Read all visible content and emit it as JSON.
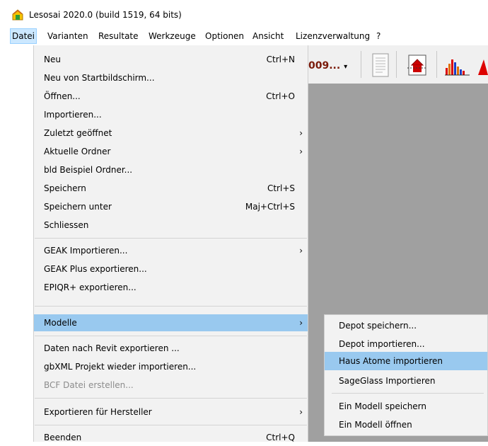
{
  "window": {
    "title": "Lesosai 2020.0 (build 1519, 64 bits)"
  },
  "menubar": {
    "items": [
      "Datei",
      "Varianten",
      "Resultate",
      "Werkzeuge",
      "Optionen",
      "Ansicht",
      "Lizenzverwaltung",
      "?"
    ]
  },
  "toolbar": {
    "combo_text": "009...",
    "combo_arrow": "▾"
  },
  "file_menu": {
    "items": [
      {
        "label": "Neu",
        "shortcut": "Ctrl+N"
      },
      {
        "label": "Neu von Startbildschirm..."
      },
      {
        "label": "Öffnen...",
        "shortcut": "Ctrl+O"
      },
      {
        "label": "Importieren..."
      },
      {
        "label": "Zuletzt geöffnet",
        "arrow": "›"
      },
      {
        "label": "Aktuelle Ordner",
        "arrow": "›"
      },
      {
        "label": "bld Beispiel Ordner..."
      },
      {
        "label": "Speichern",
        "shortcut": "Ctrl+S"
      },
      {
        "label": "Speichern unter",
        "shortcut": "Maj+Ctrl+S"
      },
      {
        "label": "Schliessen"
      },
      {
        "label": "GEAK Importieren...",
        "arrow": "›"
      },
      {
        "label": "GEAK Plus exportieren..."
      },
      {
        "label": "EPIQR+ exportieren..."
      },
      {
        "label": "Modelle",
        "arrow": "›",
        "highlighted": true
      },
      {
        "label": "Daten nach Revit exportieren ..."
      },
      {
        "label": "gbXML Projekt wieder importieren..."
      },
      {
        "label": "BCF Datei erstellen...",
        "disabled": true
      },
      {
        "label": "Exportieren für Hersteller",
        "arrow": "›"
      },
      {
        "label": "Beenden",
        "shortcut": "Ctrl+Q"
      }
    ]
  },
  "modelle_submenu": {
    "items": [
      {
        "label": "Depot speichern..."
      },
      {
        "label": "Depot importieren..."
      },
      {
        "label": "Haus Atome importieren",
        "highlighted": true
      },
      {
        "label": "SageGlass Importieren"
      },
      {
        "label": "Ein Modell speichern"
      },
      {
        "label": "Ein Modell öffnen"
      }
    ]
  },
  "colors": {
    "highlight": "#99c9ef",
    "menu_bg": "#f2f2f2",
    "workspace": "#a0a0a0",
    "active_menu": "#cce8ff"
  }
}
